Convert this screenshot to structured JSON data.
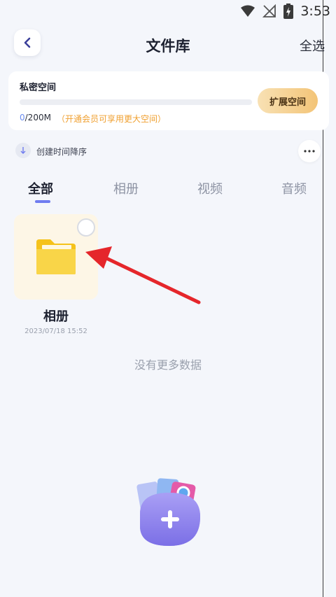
{
  "status_bar": {
    "time": "3:53"
  },
  "header": {
    "title": "文件库",
    "select_all": "全选"
  },
  "storage": {
    "title": "私密空间",
    "used": "0",
    "total": "/200M",
    "promo": "（开通会员可享用更大空间）",
    "expand_button": "扩展空间",
    "usage_fraction": 0
  },
  "sort": {
    "label": "创建时间降序"
  },
  "tabs": [
    {
      "label": "全部",
      "active": true
    },
    {
      "label": "相册",
      "active": false
    },
    {
      "label": "视频",
      "active": false
    },
    {
      "label": "音频",
      "active": false
    }
  ],
  "items": [
    {
      "name": "相册",
      "date": "2023/07/18 15:52",
      "icon": "folder-icon"
    }
  ],
  "empty_message": "没有更多数据",
  "colors": {
    "accent": "#6f7cf0",
    "folder": "#f8cf2e",
    "arrow": "#e5262b",
    "promo": "#f0a030"
  }
}
